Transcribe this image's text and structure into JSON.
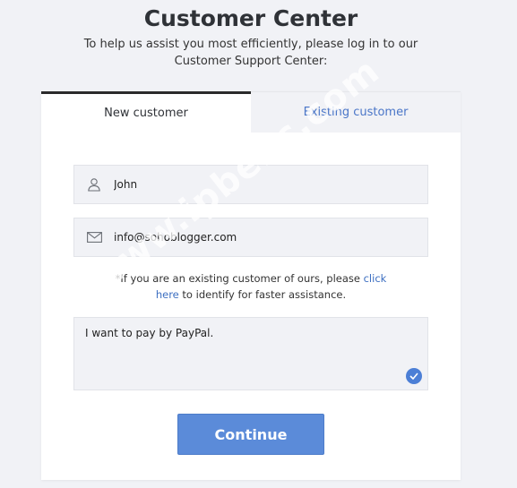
{
  "header": {
    "title": "Customer Center",
    "subtitle": "To help us assist you most efficiently, please log in to our Customer Support Center:"
  },
  "tabs": [
    {
      "label": "New customer",
      "active": true
    },
    {
      "label": "Existing customer",
      "active": false
    }
  ],
  "form": {
    "name": {
      "value": "John",
      "icon": "user-icon"
    },
    "email": {
      "value": "info@sohoblogger.com",
      "icon": "envelope-icon"
    },
    "note": {
      "text": "*If you are an existing customer of ours, please ",
      "link1": "click",
      "link2": "here",
      "text2": " to identify for faster assistance."
    },
    "message": {
      "value": "I want to pay by PayPal.",
      "icon": "checkmark-icon"
    },
    "continue_label": "Continue"
  },
  "watermark": "www.ipbenc.com",
  "colors": {
    "accent": "#5b8bd9",
    "link": "#3d6fc1",
    "background": "#f1f2f6"
  }
}
